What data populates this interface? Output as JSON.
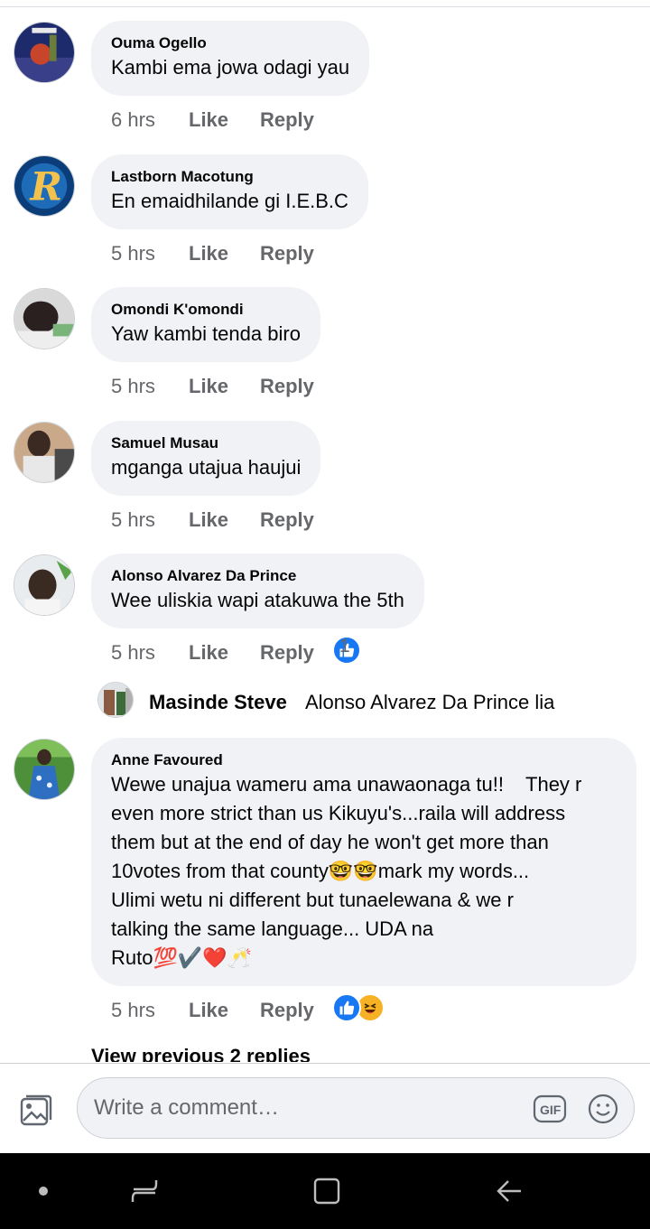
{
  "comments": [
    {
      "author": "Ouma Ogello",
      "text": "Kambi ema jowa odagi yau",
      "time": "6 hrs",
      "like": "Like",
      "reply": "Reply"
    },
    {
      "author": "Lastborn Macotung",
      "text": "En emaidhilande gi I.E.B.C",
      "time": "5 hrs",
      "like": "Like",
      "reply": "Reply"
    },
    {
      "author": "Omondi K'omondi",
      "text": "Yaw kambi tenda biro",
      "time": "5 hrs",
      "like": "Like",
      "reply": "Reply"
    },
    {
      "author": "Samuel Musau",
      "text": "mganga utajua haujui",
      "time": "5 hrs",
      "like": "Like",
      "reply": "Reply"
    },
    {
      "author": "Alonso Alvarez Da Prince",
      "text": "Wee uliskia wapi atakuwa the 5th",
      "time": "5 hrs",
      "like": "Like",
      "reply": "Reply",
      "reaction_count": "1"
    },
    {
      "author": "Anne Favoured",
      "text_lines": [
        "Wewe unajua wameru ama unawaonaga tu!!    They r",
        "even more strict than us Kikuyu's...raila will address",
        "them but at the end of day he won't get more than",
        "10votes from that county🤓🤓mark my words...",
        "Ulimi wetu ni different but tunaelewana & we r",
        "talking the same language... UDA na",
        "Ruto💯✔️❤️🥂"
      ],
      "time": "5 hrs",
      "like": "Like",
      "reply": "Reply",
      "reaction_count": "2"
    }
  ],
  "nested_reply": {
    "author": "Masinde Steve",
    "text": "Alonso Alvarez Da Prince lia"
  },
  "view_previous": "View previous 2 replies",
  "composer": {
    "placeholder": "Write a comment…",
    "gif_label": "GIF"
  },
  "colors": {
    "bubble": "#f0f2f5",
    "meta": "#65676b",
    "like_blue": "#1877f2",
    "nav_bg": "#000000"
  }
}
